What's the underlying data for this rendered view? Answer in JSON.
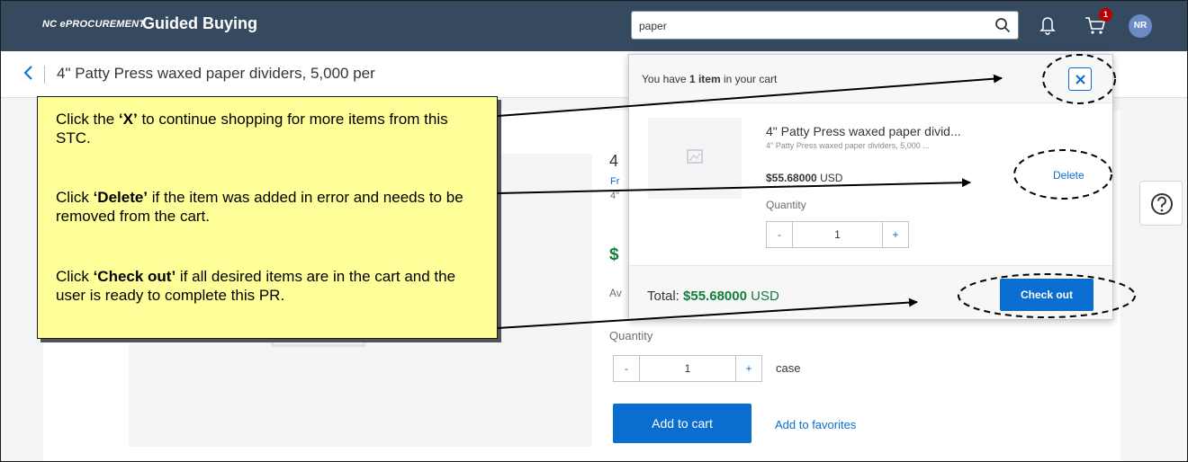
{
  "topbar": {
    "logo": "NC ePROCUREMENT",
    "title": "Guided Buying",
    "search_value": "paper",
    "cart_count": "1",
    "avatar_initials": "NR"
  },
  "header": {
    "title": "4\" Patty Press waxed paper dividers, 5,000 per"
  },
  "product": {
    "title_fragment": "4",
    "link_fragment": "Fr",
    "desc_fragment": "4\"",
    "price_fragment": "$",
    "avail_fragment": "Av",
    "quantity_label": "Quantity",
    "quantity_value": "1",
    "minus": "-",
    "plus": "+",
    "unit": "case",
    "add_to_cart": "Add to cart",
    "add_to_favorites": "Add to favorites"
  },
  "help": {
    "icon": "help-circle-icon"
  },
  "cart_popover": {
    "header_prefix": "You have ",
    "header_count": "1 item",
    "header_suffix": " in your cart",
    "item": {
      "title": "4\" Patty Press waxed paper divid...",
      "subtitle": "4\" Patty Press waxed paper dividers, 5,000 ...",
      "price": "$55.68000",
      "currency": " USD",
      "delete_label": "Delete",
      "quantity_label": "Quantity",
      "quantity_value": "1",
      "minus": "-",
      "plus": "+"
    },
    "total_label": "Total: ",
    "total_amount": "$55.68000",
    "total_currency": " USD",
    "checkout_label": "Check out"
  },
  "callout": {
    "p1_pre": "Click the ",
    "p1_bold": "‘X’",
    "p1_post": " to continue shopping for more items from this STC.",
    "p2_pre": "Click ",
    "p2_bold": "‘Delete’",
    "p2_post": " if the item was added in error and needs to be removed from the cart.",
    "p3_pre": "Click ",
    "p3_bold": "‘Check out’",
    "p3_post": " if all desired items are in the cart and the user is ready to complete this PR."
  },
  "colors": {
    "shell_bar": "#354a5f",
    "accent": "#0a6ed1",
    "price_green": "#107e3e",
    "callout_fill": "#ffff99",
    "badge": "#bb0000"
  }
}
